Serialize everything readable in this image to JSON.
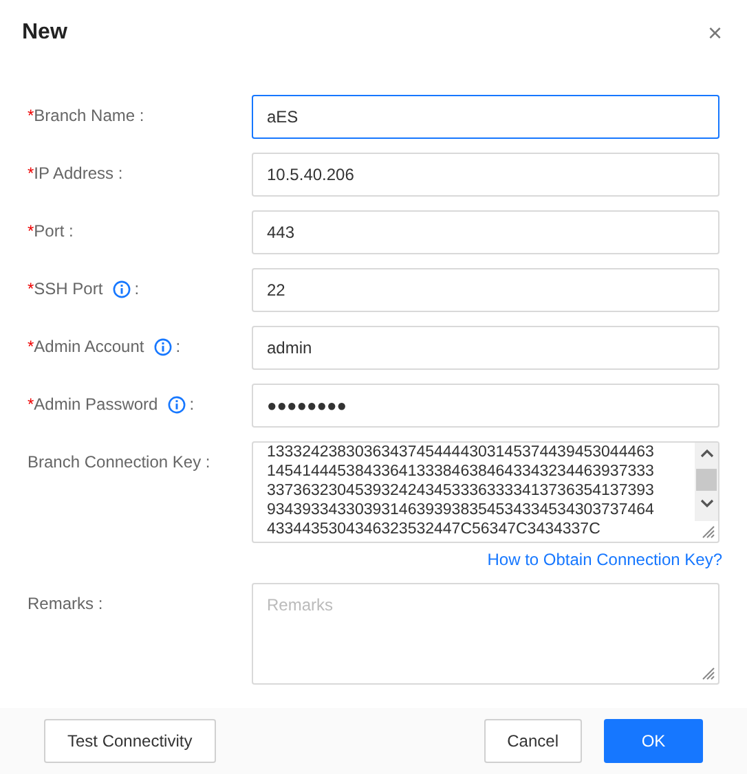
{
  "dialog": {
    "title": "New",
    "close": "×"
  },
  "required_mark": "*",
  "fields": [
    {
      "kind": "input",
      "label": "Branch Name :",
      "required": true,
      "info": false,
      "value": "aES",
      "focused": true
    },
    {
      "kind": "input",
      "label": "IP Address :",
      "required": true,
      "info": false,
      "value": "10.5.40.206",
      "focused": false
    },
    {
      "kind": "input",
      "label": "Port :",
      "required": true,
      "info": false,
      "value": "443",
      "focused": false
    },
    {
      "kind": "input",
      "label": "SSH Port",
      "suffix": ":",
      "required": true,
      "info": true,
      "value": "22",
      "focused": false
    },
    {
      "kind": "input",
      "label": "Admin Account",
      "suffix": ":",
      "required": true,
      "info": true,
      "value": "admin",
      "focused": false
    },
    {
      "kind": "input",
      "label": "Admin Password",
      "suffix": ":",
      "required": true,
      "info": true,
      "value": "●●●●●●●●",
      "focused": false
    },
    {
      "kind": "textarea",
      "label": "Branch Connection Key :",
      "required": false,
      "info": false,
      "lines": [
        "13332423830363437454444303145374439453044463",
        "14541444538433641333846384643343234463937333",
        "33736323045393242434533363333413736354137393",
        "93439334330393146393938354534334534303737464",
        "4334435304346323532447C56347C3434337C"
      ],
      "link": "How to Obtain Connection Key?"
    },
    {
      "kind": "textarea",
      "label": "Remarks :",
      "required": false,
      "info": false,
      "placeholder": "Remarks"
    }
  ],
  "buttons": [
    {
      "label": "Test Connectivity",
      "primary": false
    },
    {
      "label": "Cancel",
      "primary": false
    },
    {
      "label": "OK",
      "primary": true
    }
  ]
}
